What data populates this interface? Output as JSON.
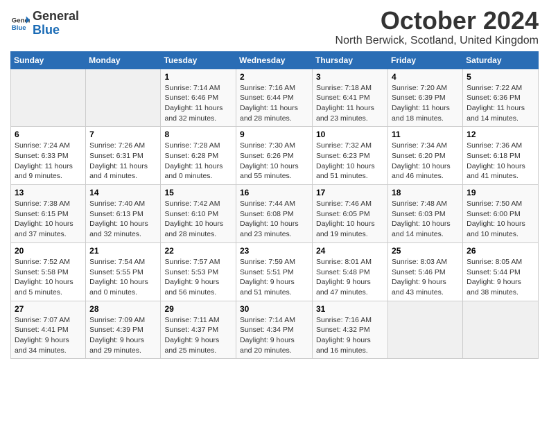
{
  "logo": {
    "general": "General",
    "blue": "Blue"
  },
  "title": "October 2024",
  "location": "North Berwick, Scotland, United Kingdom",
  "days_of_week": [
    "Sunday",
    "Monday",
    "Tuesday",
    "Wednesday",
    "Thursday",
    "Friday",
    "Saturday"
  ],
  "weeks": [
    [
      {
        "day": "",
        "info": ""
      },
      {
        "day": "",
        "info": ""
      },
      {
        "day": "1",
        "info": "Sunrise: 7:14 AM\nSunset: 6:46 PM\nDaylight: 11 hours\nand 32 minutes."
      },
      {
        "day": "2",
        "info": "Sunrise: 7:16 AM\nSunset: 6:44 PM\nDaylight: 11 hours\nand 28 minutes."
      },
      {
        "day": "3",
        "info": "Sunrise: 7:18 AM\nSunset: 6:41 PM\nDaylight: 11 hours\nand 23 minutes."
      },
      {
        "day": "4",
        "info": "Sunrise: 7:20 AM\nSunset: 6:39 PM\nDaylight: 11 hours\nand 18 minutes."
      },
      {
        "day": "5",
        "info": "Sunrise: 7:22 AM\nSunset: 6:36 PM\nDaylight: 11 hours\nand 14 minutes."
      }
    ],
    [
      {
        "day": "6",
        "info": "Sunrise: 7:24 AM\nSunset: 6:33 PM\nDaylight: 11 hours\nand 9 minutes."
      },
      {
        "day": "7",
        "info": "Sunrise: 7:26 AM\nSunset: 6:31 PM\nDaylight: 11 hours\nand 4 minutes."
      },
      {
        "day": "8",
        "info": "Sunrise: 7:28 AM\nSunset: 6:28 PM\nDaylight: 11 hours\nand 0 minutes."
      },
      {
        "day": "9",
        "info": "Sunrise: 7:30 AM\nSunset: 6:26 PM\nDaylight: 10 hours\nand 55 minutes."
      },
      {
        "day": "10",
        "info": "Sunrise: 7:32 AM\nSunset: 6:23 PM\nDaylight: 10 hours\nand 51 minutes."
      },
      {
        "day": "11",
        "info": "Sunrise: 7:34 AM\nSunset: 6:20 PM\nDaylight: 10 hours\nand 46 minutes."
      },
      {
        "day": "12",
        "info": "Sunrise: 7:36 AM\nSunset: 6:18 PM\nDaylight: 10 hours\nand 41 minutes."
      }
    ],
    [
      {
        "day": "13",
        "info": "Sunrise: 7:38 AM\nSunset: 6:15 PM\nDaylight: 10 hours\nand 37 minutes."
      },
      {
        "day": "14",
        "info": "Sunrise: 7:40 AM\nSunset: 6:13 PM\nDaylight: 10 hours\nand 32 minutes."
      },
      {
        "day": "15",
        "info": "Sunrise: 7:42 AM\nSunset: 6:10 PM\nDaylight: 10 hours\nand 28 minutes."
      },
      {
        "day": "16",
        "info": "Sunrise: 7:44 AM\nSunset: 6:08 PM\nDaylight: 10 hours\nand 23 minutes."
      },
      {
        "day": "17",
        "info": "Sunrise: 7:46 AM\nSunset: 6:05 PM\nDaylight: 10 hours\nand 19 minutes."
      },
      {
        "day": "18",
        "info": "Sunrise: 7:48 AM\nSunset: 6:03 PM\nDaylight: 10 hours\nand 14 minutes."
      },
      {
        "day": "19",
        "info": "Sunrise: 7:50 AM\nSunset: 6:00 PM\nDaylight: 10 hours\nand 10 minutes."
      }
    ],
    [
      {
        "day": "20",
        "info": "Sunrise: 7:52 AM\nSunset: 5:58 PM\nDaylight: 10 hours\nand 5 minutes."
      },
      {
        "day": "21",
        "info": "Sunrise: 7:54 AM\nSunset: 5:55 PM\nDaylight: 10 hours\nand 0 minutes."
      },
      {
        "day": "22",
        "info": "Sunrise: 7:57 AM\nSunset: 5:53 PM\nDaylight: 9 hours\nand 56 minutes."
      },
      {
        "day": "23",
        "info": "Sunrise: 7:59 AM\nSunset: 5:51 PM\nDaylight: 9 hours\nand 51 minutes."
      },
      {
        "day": "24",
        "info": "Sunrise: 8:01 AM\nSunset: 5:48 PM\nDaylight: 9 hours\nand 47 minutes."
      },
      {
        "day": "25",
        "info": "Sunrise: 8:03 AM\nSunset: 5:46 PM\nDaylight: 9 hours\nand 43 minutes."
      },
      {
        "day": "26",
        "info": "Sunrise: 8:05 AM\nSunset: 5:44 PM\nDaylight: 9 hours\nand 38 minutes."
      }
    ],
    [
      {
        "day": "27",
        "info": "Sunrise: 7:07 AM\nSunset: 4:41 PM\nDaylight: 9 hours\nand 34 minutes."
      },
      {
        "day": "28",
        "info": "Sunrise: 7:09 AM\nSunset: 4:39 PM\nDaylight: 9 hours\nand 29 minutes."
      },
      {
        "day": "29",
        "info": "Sunrise: 7:11 AM\nSunset: 4:37 PM\nDaylight: 9 hours\nand 25 minutes."
      },
      {
        "day": "30",
        "info": "Sunrise: 7:14 AM\nSunset: 4:34 PM\nDaylight: 9 hours\nand 20 minutes."
      },
      {
        "day": "31",
        "info": "Sunrise: 7:16 AM\nSunset: 4:32 PM\nDaylight: 9 hours\nand 16 minutes."
      },
      {
        "day": "",
        "info": ""
      },
      {
        "day": "",
        "info": ""
      }
    ]
  ]
}
